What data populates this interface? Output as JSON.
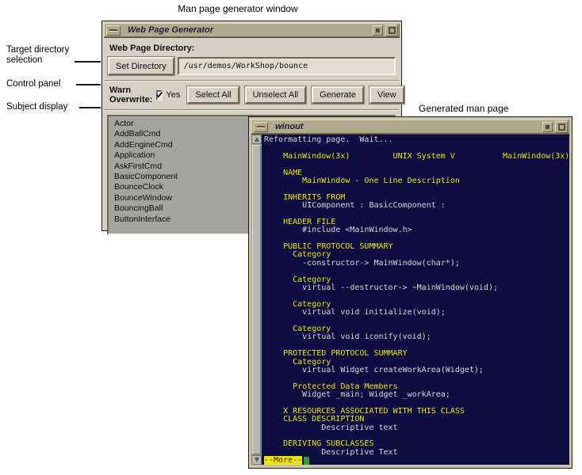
{
  "annotations": {
    "top_label": "Man page generator window",
    "right_label": "Generated man page",
    "left_labels": [
      {
        "label": "Target directory selection"
      },
      {
        "label": "Control panel"
      },
      {
        "label": "Subject display"
      }
    ]
  },
  "generator_window": {
    "title": "Web Page Generator",
    "directory_label": "Web Page Directory:",
    "set_directory_button": "Set Directory",
    "directory_value": "/usr/demos/WorkShop/bounce",
    "warn_overwrite_label": "Warn Overwrite:",
    "warn_overwrite_checked": true,
    "warn_overwrite_option": "Yes",
    "buttons": [
      "Select All",
      "Unselect All",
      "Generate",
      "View"
    ],
    "subjects": [
      "Actor",
      "AddBallCmd",
      "AddEngineCmd",
      "Application",
      "AskFirstCmd",
      "BasicComponent",
      "BounceClock",
      "BounceWindow",
      "BouncingBall",
      "ButtonInterface"
    ]
  },
  "winout_window": {
    "title": "winout",
    "more_indicator": "--More--",
    "terminal_lines": [
      [
        "w",
        "Reformatting page.  Wait..."
      ],
      [
        "w",
        ""
      ],
      [
        "y",
        "    MainWindow(3x)         UNIX System V          MainWindow(3x)"
      ],
      [
        "w",
        ""
      ],
      [
        "y",
        "    NAME"
      ],
      [
        "y",
        "        MainWindow - One Line Description"
      ],
      [
        "w",
        ""
      ],
      [
        "y",
        "    INHERITS FROM"
      ],
      [
        "w",
        "        UIComponent : BasicComponent :"
      ],
      [
        "w",
        ""
      ],
      [
        "y",
        "    HEADER FILE"
      ],
      [
        "w",
        "        #include <MainWindow.h>"
      ],
      [
        "w",
        ""
      ],
      [
        "y",
        "    PUBLIC PROTOCOL SUMMARY"
      ],
      [
        "y",
        "      Category"
      ],
      [
        "w",
        "        -constructor-> MainWindow(char*);"
      ],
      [
        "w",
        ""
      ],
      [
        "y",
        "      Category"
      ],
      [
        "w",
        "        virtual --destructor-> ~MainWindow(void);"
      ],
      [
        "w",
        ""
      ],
      [
        "y",
        "      Category"
      ],
      [
        "w",
        "        virtual void initialize(void);"
      ],
      [
        "w",
        ""
      ],
      [
        "y",
        "      Category"
      ],
      [
        "w",
        "        virtual void iconify(void);"
      ],
      [
        "w",
        ""
      ],
      [
        "y",
        "    PROTECTED PROTOCOL SUMMARY"
      ],
      [
        "y",
        "      Category"
      ],
      [
        "w",
        "        virtual Widget createWorkArea(Widget);"
      ],
      [
        "w",
        ""
      ],
      [
        "y",
        "      Protected Data Members"
      ],
      [
        "w",
        "        Widget _main; Widget _workArea;"
      ],
      [
        "w",
        ""
      ],
      [
        "y",
        "    X RESOURCES ASSOCIATED WITH THIS CLASS"
      ],
      [
        "y",
        "    CLASS DESCRIPTION"
      ],
      [
        "w",
        "            Descriptive text"
      ],
      [
        "w",
        ""
      ],
      [
        "y",
        "    DERIVING SUBCLASSES"
      ],
      [
        "w",
        "            Descriptive Text"
      ]
    ]
  },
  "colors": {
    "titlebar": "#b1a98d",
    "window_chrome": "#d5d1c7",
    "terminal_background": "#0d0d42",
    "terminal_yellow": "#e9e607",
    "terminal_white": "#d8d8d2",
    "more_background": "#e9e607",
    "more_text": "#4d1a00",
    "cursor_green": "#2fa02f",
    "list_background": "#a3a3a0"
  }
}
